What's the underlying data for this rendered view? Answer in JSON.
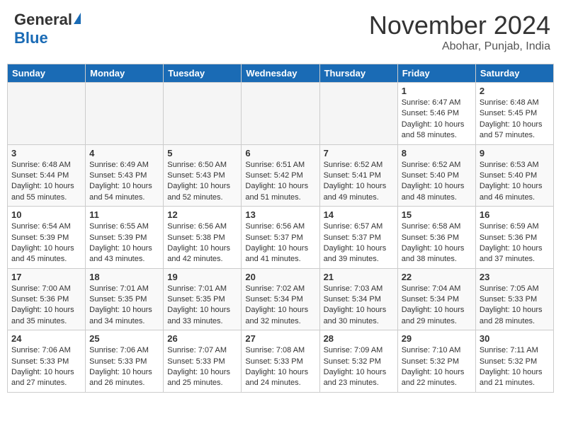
{
  "header": {
    "logo_general": "General",
    "logo_blue": "Blue",
    "month_title": "November 2024",
    "location": "Abohar, Punjab, India"
  },
  "days_of_week": [
    "Sunday",
    "Monday",
    "Tuesday",
    "Wednesday",
    "Thursday",
    "Friday",
    "Saturday"
  ],
  "weeks": [
    [
      {
        "day": "",
        "info": ""
      },
      {
        "day": "",
        "info": ""
      },
      {
        "day": "",
        "info": ""
      },
      {
        "day": "",
        "info": ""
      },
      {
        "day": "",
        "info": ""
      },
      {
        "day": "1",
        "info": "Sunrise: 6:47 AM\nSunset: 5:46 PM\nDaylight: 10 hours and 58 minutes."
      },
      {
        "day": "2",
        "info": "Sunrise: 6:48 AM\nSunset: 5:45 PM\nDaylight: 10 hours and 57 minutes."
      }
    ],
    [
      {
        "day": "3",
        "info": "Sunrise: 6:48 AM\nSunset: 5:44 PM\nDaylight: 10 hours and 55 minutes."
      },
      {
        "day": "4",
        "info": "Sunrise: 6:49 AM\nSunset: 5:43 PM\nDaylight: 10 hours and 54 minutes."
      },
      {
        "day": "5",
        "info": "Sunrise: 6:50 AM\nSunset: 5:43 PM\nDaylight: 10 hours and 52 minutes."
      },
      {
        "day": "6",
        "info": "Sunrise: 6:51 AM\nSunset: 5:42 PM\nDaylight: 10 hours and 51 minutes."
      },
      {
        "day": "7",
        "info": "Sunrise: 6:52 AM\nSunset: 5:41 PM\nDaylight: 10 hours and 49 minutes."
      },
      {
        "day": "8",
        "info": "Sunrise: 6:52 AM\nSunset: 5:40 PM\nDaylight: 10 hours and 48 minutes."
      },
      {
        "day": "9",
        "info": "Sunrise: 6:53 AM\nSunset: 5:40 PM\nDaylight: 10 hours and 46 minutes."
      }
    ],
    [
      {
        "day": "10",
        "info": "Sunrise: 6:54 AM\nSunset: 5:39 PM\nDaylight: 10 hours and 45 minutes."
      },
      {
        "day": "11",
        "info": "Sunrise: 6:55 AM\nSunset: 5:39 PM\nDaylight: 10 hours and 43 minutes."
      },
      {
        "day": "12",
        "info": "Sunrise: 6:56 AM\nSunset: 5:38 PM\nDaylight: 10 hours and 42 minutes."
      },
      {
        "day": "13",
        "info": "Sunrise: 6:56 AM\nSunset: 5:37 PM\nDaylight: 10 hours and 41 minutes."
      },
      {
        "day": "14",
        "info": "Sunrise: 6:57 AM\nSunset: 5:37 PM\nDaylight: 10 hours and 39 minutes."
      },
      {
        "day": "15",
        "info": "Sunrise: 6:58 AM\nSunset: 5:36 PM\nDaylight: 10 hours and 38 minutes."
      },
      {
        "day": "16",
        "info": "Sunrise: 6:59 AM\nSunset: 5:36 PM\nDaylight: 10 hours and 37 minutes."
      }
    ],
    [
      {
        "day": "17",
        "info": "Sunrise: 7:00 AM\nSunset: 5:36 PM\nDaylight: 10 hours and 35 minutes."
      },
      {
        "day": "18",
        "info": "Sunrise: 7:01 AM\nSunset: 5:35 PM\nDaylight: 10 hours and 34 minutes."
      },
      {
        "day": "19",
        "info": "Sunrise: 7:01 AM\nSunset: 5:35 PM\nDaylight: 10 hours and 33 minutes."
      },
      {
        "day": "20",
        "info": "Sunrise: 7:02 AM\nSunset: 5:34 PM\nDaylight: 10 hours and 32 minutes."
      },
      {
        "day": "21",
        "info": "Sunrise: 7:03 AM\nSunset: 5:34 PM\nDaylight: 10 hours and 30 minutes."
      },
      {
        "day": "22",
        "info": "Sunrise: 7:04 AM\nSunset: 5:34 PM\nDaylight: 10 hours and 29 minutes."
      },
      {
        "day": "23",
        "info": "Sunrise: 7:05 AM\nSunset: 5:33 PM\nDaylight: 10 hours and 28 minutes."
      }
    ],
    [
      {
        "day": "24",
        "info": "Sunrise: 7:06 AM\nSunset: 5:33 PM\nDaylight: 10 hours and 27 minutes."
      },
      {
        "day": "25",
        "info": "Sunrise: 7:06 AM\nSunset: 5:33 PM\nDaylight: 10 hours and 26 minutes."
      },
      {
        "day": "26",
        "info": "Sunrise: 7:07 AM\nSunset: 5:33 PM\nDaylight: 10 hours and 25 minutes."
      },
      {
        "day": "27",
        "info": "Sunrise: 7:08 AM\nSunset: 5:33 PM\nDaylight: 10 hours and 24 minutes."
      },
      {
        "day": "28",
        "info": "Sunrise: 7:09 AM\nSunset: 5:32 PM\nDaylight: 10 hours and 23 minutes."
      },
      {
        "day": "29",
        "info": "Sunrise: 7:10 AM\nSunset: 5:32 PM\nDaylight: 10 hours and 22 minutes."
      },
      {
        "day": "30",
        "info": "Sunrise: 7:11 AM\nSunset: 5:32 PM\nDaylight: 10 hours and 21 minutes."
      }
    ]
  ]
}
